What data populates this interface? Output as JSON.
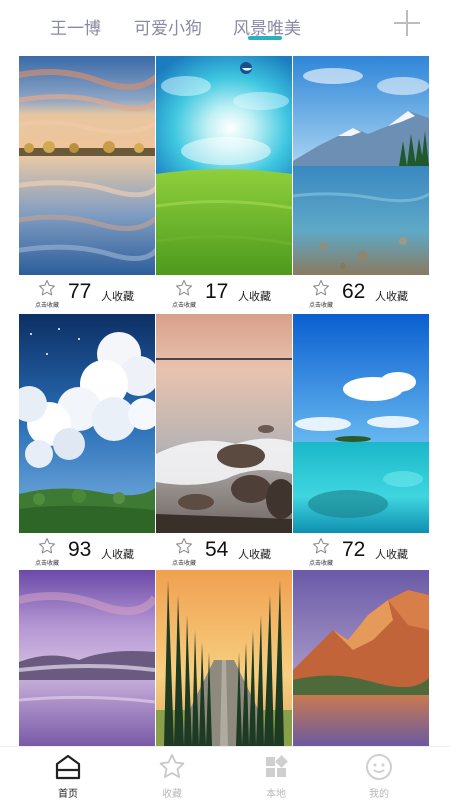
{
  "tabs": [
    {
      "label": "王一博",
      "active": false
    },
    {
      "label": "可爱小狗",
      "active": false
    },
    {
      "label": "风景唯美",
      "active": true
    }
  ],
  "add_icon": "plus-icon",
  "accent_color": "#2bb0c0",
  "cards": [
    {
      "count": "77",
      "count_label": "人收藏",
      "star_caption": "点击收藏",
      "scene": "lake-sunset"
    },
    {
      "count": "17",
      "count_label": "人收藏",
      "star_caption": "点击收藏",
      "scene": "green-meadow"
    },
    {
      "count": "62",
      "count_label": "人收藏",
      "star_caption": "点击收藏",
      "scene": "mountain-lake"
    },
    {
      "count": "93",
      "count_label": "人收藏",
      "star_caption": "点击收藏",
      "scene": "clouds-hills"
    },
    {
      "count": "54",
      "count_label": "人收藏",
      "star_caption": "点击收藏",
      "scene": "rocky-shore"
    },
    {
      "count": "72",
      "count_label": "人收藏",
      "star_caption": "点击收藏",
      "scene": "tropical-sea"
    },
    {
      "count": "",
      "count_label": "",
      "star_caption": "",
      "scene": "purple-lake"
    },
    {
      "count": "",
      "count_label": "",
      "star_caption": "",
      "scene": "tree-road"
    },
    {
      "count": "",
      "count_label": "",
      "star_caption": "",
      "scene": "red-mountain"
    }
  ],
  "bottom_nav": [
    {
      "label": "首页",
      "icon": "home-icon",
      "active": true
    },
    {
      "label": "收藏",
      "icon": "star-icon",
      "active": false
    },
    {
      "label": "本地",
      "icon": "grid-icon",
      "active": false
    },
    {
      "label": "我的",
      "icon": "smile-icon",
      "active": false
    }
  ]
}
